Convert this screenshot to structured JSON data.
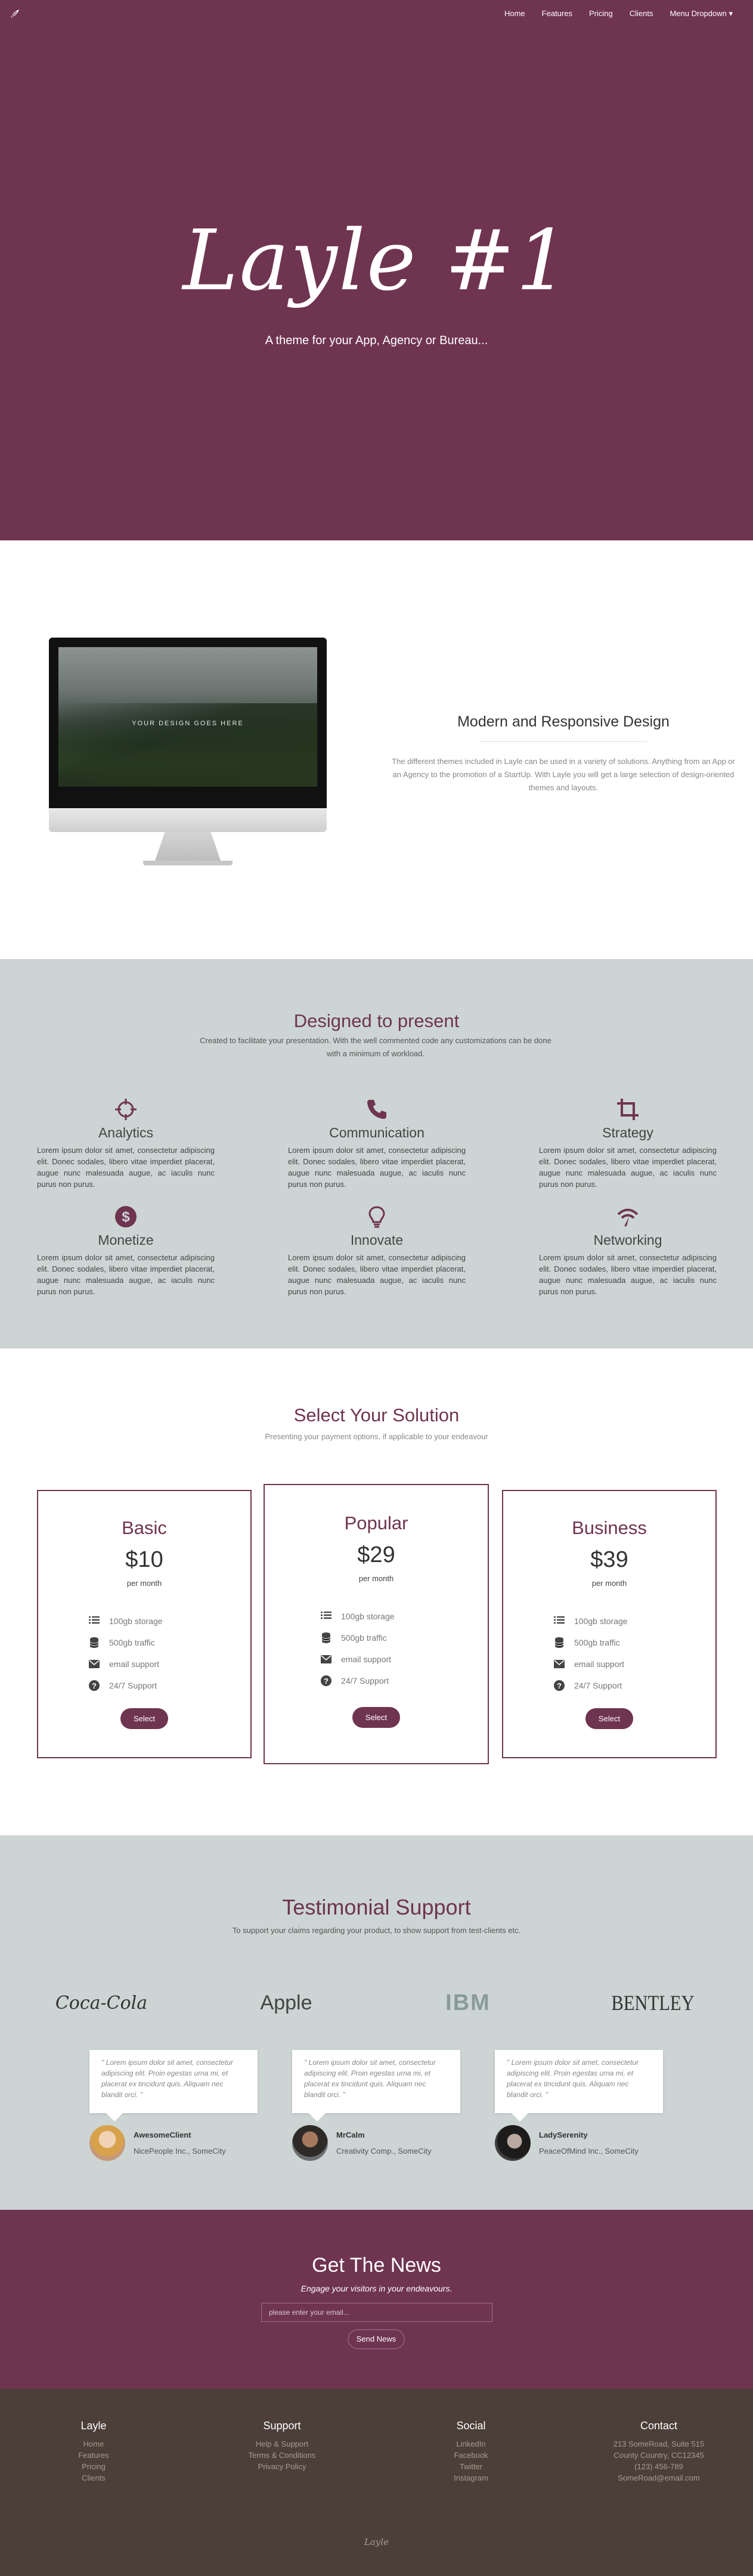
{
  "nav": {
    "items": [
      "Home",
      "Features",
      "Pricing",
      "Clients",
      "Menu Dropdown ▾"
    ]
  },
  "hero": {
    "title": "Layle #1",
    "subtitle": "A theme for your App, Agency or Bureau..."
  },
  "responsive": {
    "screen_text": "YOUR DESIGN GOES HERE",
    "title": "Modern and Responsive Design",
    "body": "The different themes included in Layle can be used in a variety of solutions. Anything from an App or an Agency to the promotion of a StartUp. With Layle you will get a large selection of design-oriented themes and layouts."
  },
  "features": {
    "title": "Designed to present",
    "desc": "Created to facilitate your presentation. With the well commented code any customizations can be done with a minimum of workload.",
    "items": [
      {
        "title": "Analytics",
        "icon": "crosshair-icon",
        "text": "Lorem ipsum dolor sit amet, consectetur adipiscing elit. Donec sodales, libero vitae imperdiet placerat, augue nunc malesuada augue, ac iaculis nunc purus non purus."
      },
      {
        "title": "Communication",
        "icon": "phone-icon",
        "text": "Lorem ipsum dolor sit amet, consectetur adipiscing elit. Donec sodales, libero vitae imperdiet placerat, augue nunc malesuada augue, ac iaculis nunc purus non purus."
      },
      {
        "title": "Strategy",
        "icon": "crop-icon",
        "text": "Lorem ipsum dolor sit amet, consectetur adipiscing elit. Donec sodales, libero vitae imperdiet placerat, augue nunc malesuada augue, ac iaculis nunc purus non purus."
      },
      {
        "title": "Monetize",
        "icon": "dollar-icon",
        "text": "Lorem ipsum dolor sit amet, consectetur adipiscing elit. Donec sodales, libero vitae imperdiet placerat, augue nunc malesuada augue, ac iaculis nunc purus non purus."
      },
      {
        "title": "Innovate",
        "icon": "lightbulb-icon",
        "text": "Lorem ipsum dolor sit amet, consectetur adipiscing elit. Donec sodales, libero vitae imperdiet placerat, augue nunc malesuada augue, ac iaculis nunc purus non purus."
      },
      {
        "title": "Networking",
        "icon": "network-icon",
        "text": "Lorem ipsum dolor sit amet, consectetur adipiscing elit. Donec sodales, libero vitae imperdiet placerat, augue nunc malesuada augue, ac iaculis nunc purus non purus."
      }
    ]
  },
  "pricing": {
    "title": "Select Your Solution",
    "desc": "Presenting your payment options, if applicable to your endeavour",
    "plans": [
      {
        "name": "Basic",
        "price": "$10",
        "period": "per month",
        "features": [
          "100gb storage",
          "500gb traffic",
          "email support",
          "24/7 Support"
        ],
        "button": "Select"
      },
      {
        "name": "Popular",
        "price": "$29",
        "period": "per month",
        "features": [
          "100gb storage",
          "500gb traffic",
          "email support",
          "24/7 Support"
        ],
        "button": "Select"
      },
      {
        "name": "Business",
        "price": "$39",
        "period": "per month",
        "features": [
          "100gb storage",
          "500gb traffic",
          "email support",
          "24/7 Support"
        ],
        "button": "Select"
      }
    ],
    "feature_icons": [
      "list-icon",
      "database-icon",
      "envelope-icon",
      "question-icon"
    ]
  },
  "testimonials": {
    "title": "Testimonial Support",
    "desc": "To support your claims regarding your product, to show support from test-clients etc.",
    "brands": [
      "Coca-Cola",
      "Apple",
      "IBM",
      "BENTLEY"
    ],
    "quotes": [
      {
        "text": "\" Lorem ipsum dolor sit amet, consectetur adipiscing elit. Proin egestas urna mi, et placerat ex tincidunt quis. Aliquam nec blandit orci. \"",
        "name": "AwesomeClient",
        "company": "NicePeople Inc., SomeCity"
      },
      {
        "text": "\" Lorem ipsum dolor sit amet, consectetur adipiscing elit. Proin egestas urna mi, et placerat ex tincidunt quis. Aliquam nec blandit orci. \"",
        "name": "MrCalm",
        "company": "Creativity Comp., SomeCity"
      },
      {
        "text": "\" Lorem ipsum dolor sit amet, consectetur adipiscing elit. Proin egestas urna mi, et placerat ex tincidunt quis. Aliquam nec blandit orci. \"",
        "name": "LadySerenity",
        "company": "PeaceOfMind Inc., SomeCity"
      }
    ]
  },
  "newsletter": {
    "title": "Get The News",
    "tagline": "Engage your visitors in your endeavours.",
    "placeholder": "please enter your email...",
    "button": "Send News"
  },
  "footer": {
    "columns": [
      {
        "title": "Layle",
        "items": [
          "Home",
          "Features",
          "Pricing",
          "Clients"
        ]
      },
      {
        "title": "Support",
        "items": [
          "Help & Support",
          "Terms & Conditions",
          "Privacy Policy"
        ]
      },
      {
        "title": "Social",
        "items": [
          "LinkedIn",
          "Facebook",
          "Twitter",
          "Instagram"
        ]
      },
      {
        "title": "Contact",
        "items": [
          "213 SomeRoad, Suite 515",
          "County Country, CC12345",
          "(123) 456-789",
          "SomeRoad@email.com"
        ]
      }
    ],
    "logo": "Layle"
  },
  "colors": {
    "brand": "#6f3450",
    "section_alt": "#ccd5d4",
    "footer": "#4b3f38"
  }
}
